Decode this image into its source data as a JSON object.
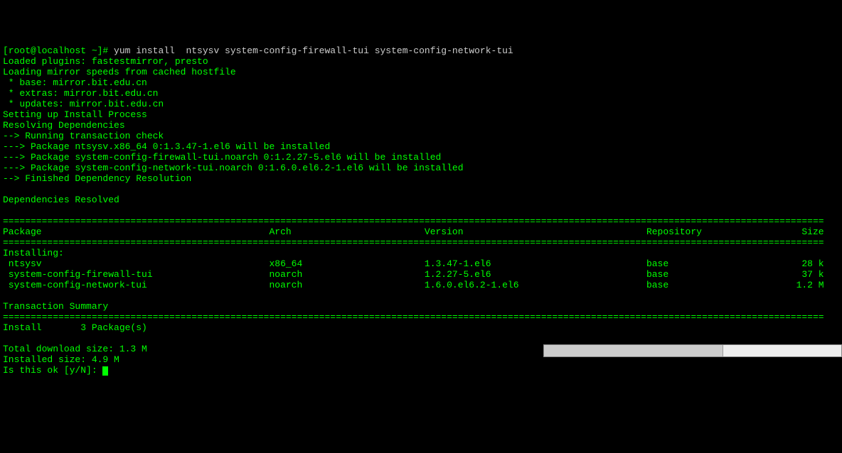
{
  "prompt": "[root@localhost ~]# ",
  "command": "yum install  ntsysv system-config-firewall-tui system-config-network-tui",
  "lines_before": "Loaded plugins: fastestmirror, presto\nLoading mirror speeds from cached hostfile\n * base: mirror.bit.edu.cn\n * extras: mirror.bit.edu.cn\n * updates: mirror.bit.edu.cn\nSetting up Install Process\nResolving Dependencies\n--> Running transaction check\n---> Package ntsysv.x86_64 0:1.3.47-1.el6 will be installed\n---> Package system-config-firewall-tui.noarch 0:1.2.27-5.el6 will be installed\n---> Package system-config-network-tui.noarch 0:1.6.0.el6.2-1.el6 will be installed\n--> Finished Dependency Resolution\n\nDependencies Resolved\n",
  "headers": {
    "package": "Package",
    "arch": "Arch",
    "version": "Version",
    "repo": "Repository",
    "size": "Size"
  },
  "installing_label": "Installing:",
  "packages": [
    {
      "name": " ntsysv",
      "arch": "x86_64",
      "version": "1.3.47-1.el6",
      "repo": "base",
      "size": "28 k"
    },
    {
      "name": " system-config-firewall-tui",
      "arch": "noarch",
      "version": "1.2.27-5.el6",
      "repo": "base",
      "size": "37 k"
    },
    {
      "name": " system-config-network-tui",
      "arch": "noarch",
      "version": "1.6.0.el6.2-1.el6",
      "repo": "base",
      "size": "1.2 M"
    }
  ],
  "txn_summary": "Transaction Summary",
  "install_line": "Install       3 Package(s)",
  "total_dl": "Total download size: 1.3 M",
  "installed_size": "Installed size: 4.9 M",
  "ok_prompt": "Is this ok [y/N]: "
}
